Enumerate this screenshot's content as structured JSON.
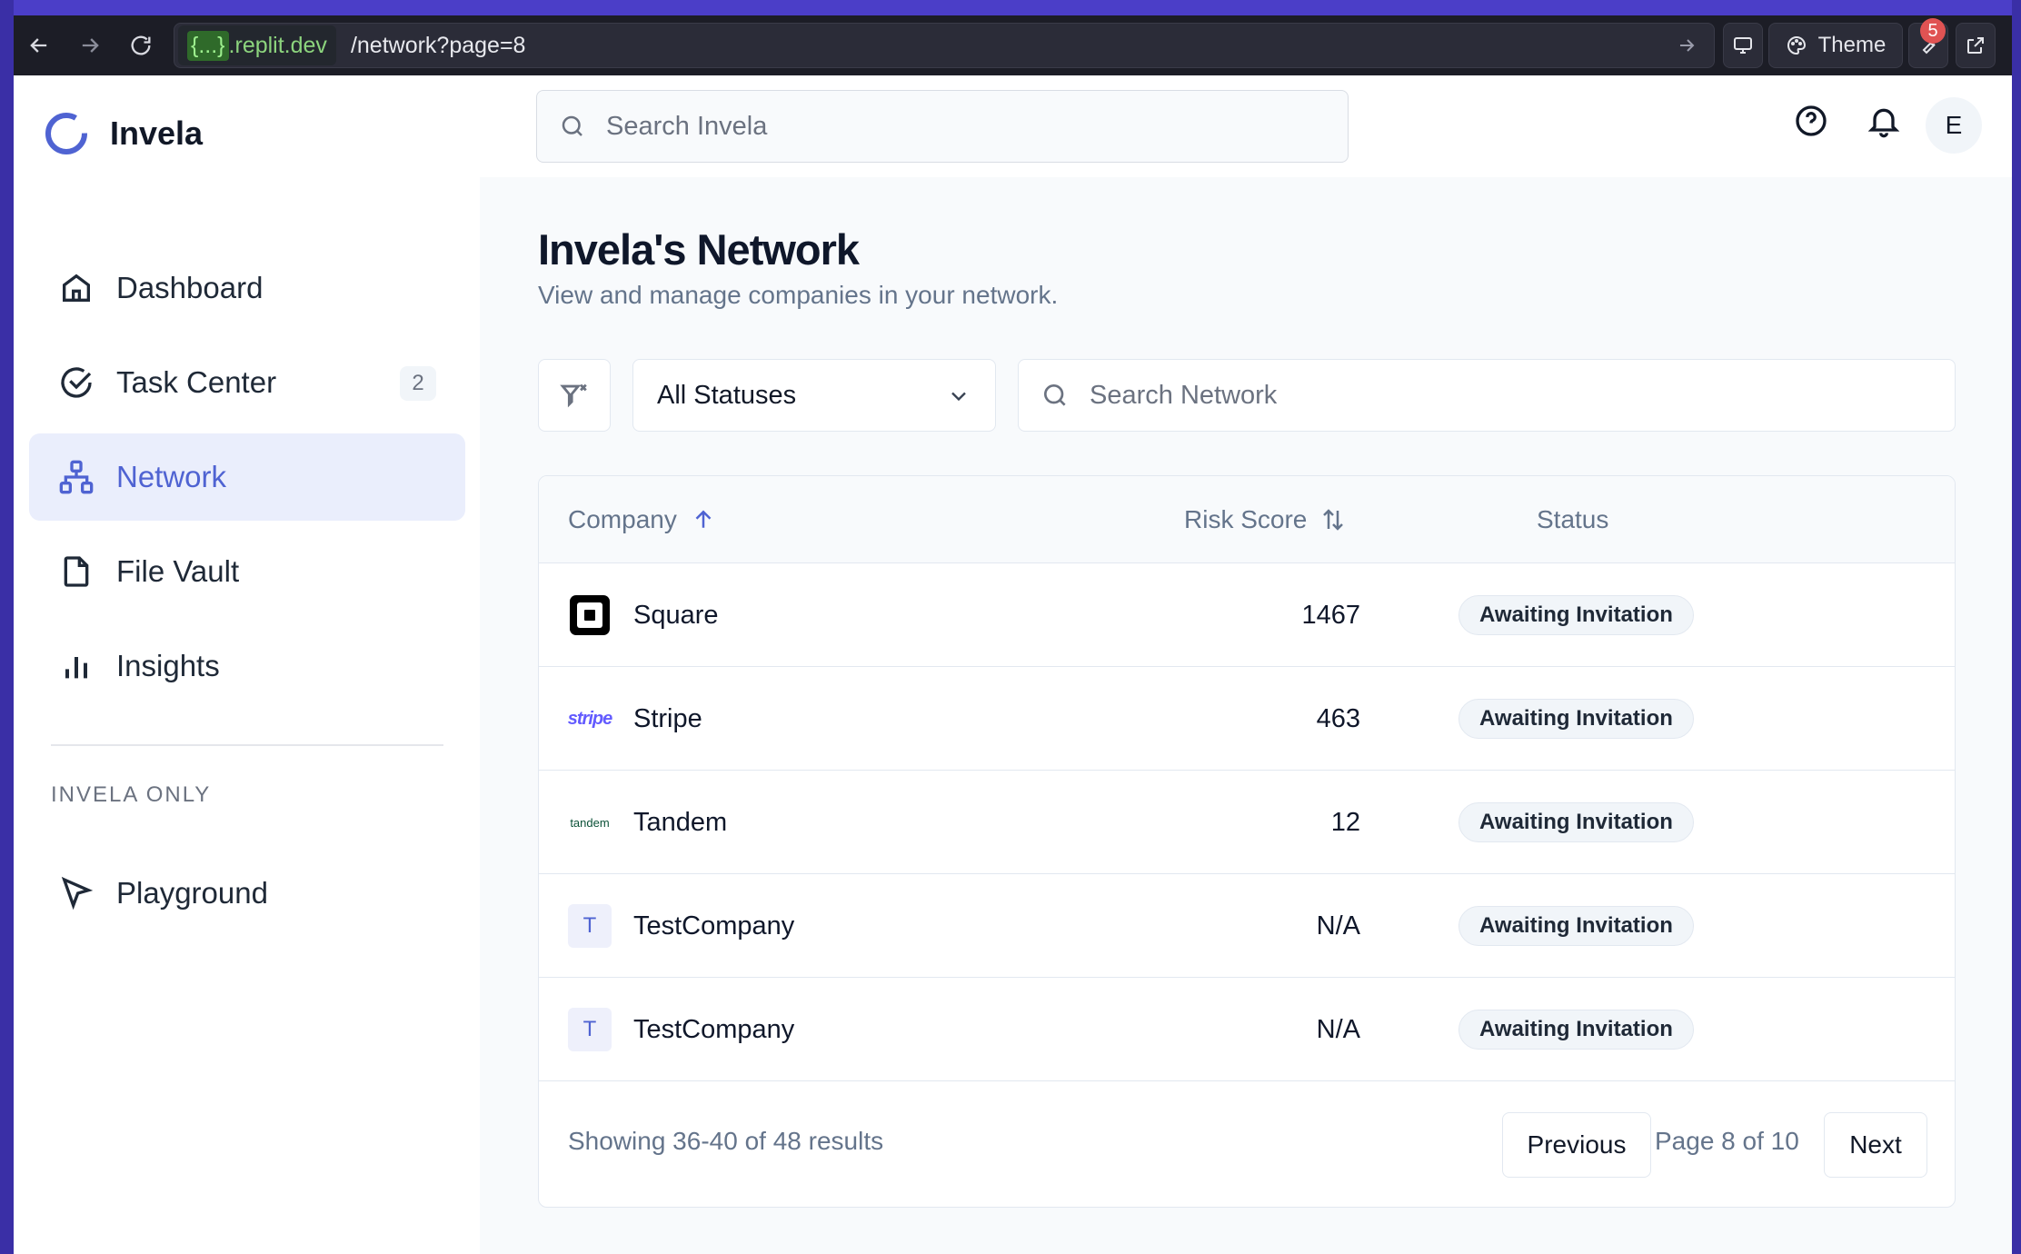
{
  "browser": {
    "url_host_brace": "{...}",
    "url_host_domain": ".replit.dev",
    "url_path": "/network?page=8",
    "theme_label": "Theme",
    "tools_badge": "5"
  },
  "app": {
    "name": "Invela",
    "search_placeholder": "Search Invela",
    "avatar_initial": "E",
    "brand_color": "#4f63d2"
  },
  "sidebar": {
    "items": [
      {
        "label": "Dashboard",
        "icon": "home-icon"
      },
      {
        "label": "Task Center",
        "icon": "check-circle-icon",
        "count": "2"
      },
      {
        "label": "Network",
        "icon": "network-icon",
        "active": true
      },
      {
        "label": "File Vault",
        "icon": "file-icon"
      },
      {
        "label": "Insights",
        "icon": "bar-chart-icon"
      }
    ],
    "section_label": "INVELA ONLY",
    "extra_items": [
      {
        "label": "Playground",
        "icon": "cursor-icon"
      }
    ]
  },
  "page": {
    "title": "Invela's Network",
    "subtitle": "View and manage companies in your network."
  },
  "filters": {
    "status_selected": "All Statuses",
    "search_placeholder": "Search Network"
  },
  "table": {
    "columns": [
      "Company",
      "Risk Score",
      "Status"
    ],
    "rows": [
      {
        "company": "Square",
        "logo": "square-logo",
        "risk_score": "1467",
        "status": "Awaiting Invitation"
      },
      {
        "company": "Stripe",
        "logo": "stripe-logo",
        "logo_text": "stripe",
        "risk_score": "463",
        "status": "Awaiting Invitation"
      },
      {
        "company": "Tandem",
        "logo": "tandem-logo",
        "logo_text": "tandem",
        "risk_score": "12",
        "status": "Awaiting Invitation"
      },
      {
        "company": "TestCompany",
        "logo": "initial",
        "initial": "T",
        "risk_score": "N/A",
        "status": "Awaiting Invitation"
      },
      {
        "company": "TestCompany",
        "logo": "initial",
        "initial": "T",
        "risk_score": "N/A",
        "status": "Awaiting Invitation"
      }
    ]
  },
  "pagination": {
    "showing": "Showing 36-40 of 48 results",
    "previous": "Previous",
    "page_info": "Page 8 of 10",
    "next": "Next"
  }
}
